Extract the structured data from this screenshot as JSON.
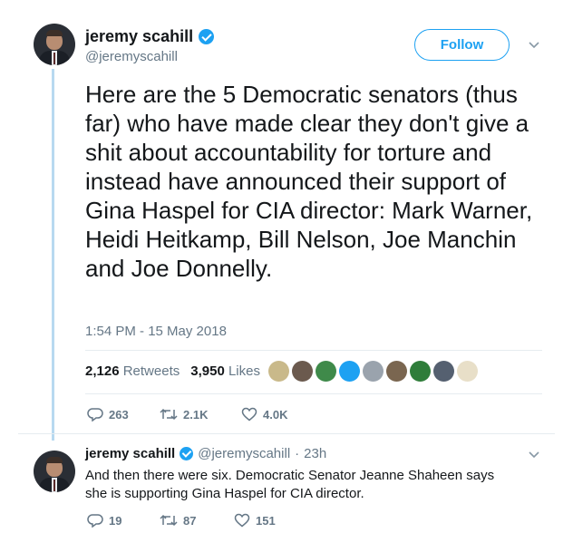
{
  "main_tweet": {
    "display_name": "jeremy scahill",
    "handle": "@jeremyscahill",
    "follow_label": "Follow",
    "text": "Here are the 5 Democratic senators (thus far) who have made clear they don't give a shit about accountability for torture and instead have announced their support of Gina Haspel for CIA director: Mark Warner, Heidi Heitkamp, Bill Nelson, Joe Manchin and Joe Donnelly.",
    "timestamp": "1:54 PM - 15 May 2018",
    "retweets_count": "2,126",
    "retweets_label": "Retweets",
    "likes_count": "3,950",
    "likes_label": "Likes",
    "liker_avatar_colors": [
      "#c9b98a",
      "#6b5a4e",
      "#3f8a4a",
      "#1da1f2",
      "#9aa3ad",
      "#7a6650",
      "#2f7d3a",
      "#556070",
      "#e8dfc8"
    ],
    "actions": {
      "replies": "263",
      "retweets": "2.1K",
      "likes": "4.0K"
    }
  },
  "reply_tweet": {
    "display_name": "jeremy scahill",
    "handle": "@jeremyscahill",
    "separator": "·",
    "time": "23h",
    "text": "And then there were six. Democratic Senator Jeanne Shaheen says she is supporting Gina Haspel for CIA director.",
    "actions": {
      "replies": "19",
      "retweets": "87",
      "likes": "151"
    }
  },
  "icons": [
    "verified-badge-icon",
    "chevron-down-icon",
    "reply-icon",
    "retweet-icon",
    "like-icon"
  ]
}
